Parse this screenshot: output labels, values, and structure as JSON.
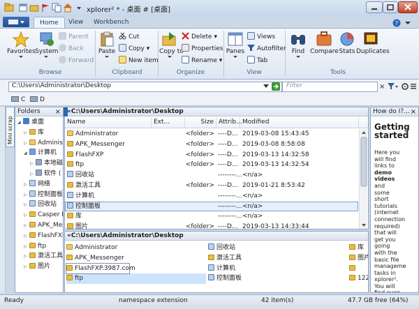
{
  "window": {
    "title": "xplorer² * - 桌面 # [桌面]"
  },
  "ribbon_tabs": [
    "Home",
    "View",
    "Workbench"
  ],
  "ribbon": {
    "browse": {
      "label": "Browse",
      "favorites": "Favorites",
      "system": "System",
      "parent": "Parent",
      "back": "Back",
      "forward": "Forward"
    },
    "clipboard": {
      "label": "Clipboard",
      "paste": "Paste",
      "cut": "Cut",
      "copy": "Copy",
      "new_item": "New item"
    },
    "organize": {
      "label": "Organize",
      "copy_to": "Copy to",
      "delete": "Delete",
      "properties": "Properties",
      "rename": "Rename"
    },
    "view": {
      "label": "View",
      "panes": "Panes",
      "views": "Views",
      "autofilter": "Autofilter",
      "tab": "Tab"
    },
    "tools": {
      "label": "Tools",
      "find": "Find",
      "compare": "Compare",
      "stats": "Stats",
      "duplicates": "Duplicates"
    }
  },
  "address": {
    "path": "C:\\Users\\Administrator\\Desktop",
    "filter_placeholder": "Filter"
  },
  "drives": [
    "C",
    "D"
  ],
  "folders_pane": {
    "title": "Folders",
    "side_tab": "Mini scrap",
    "items": [
      {
        "label": "桌面",
        "indent": 0,
        "kind": "desk"
      },
      {
        "label": "库",
        "indent": 1,
        "kind": "folder"
      },
      {
        "label": "Administ",
        "indent": 1,
        "kind": "user"
      },
      {
        "label": "计算机",
        "indent": 1,
        "kind": "pc"
      },
      {
        "label": "本地磁",
        "indent": 2,
        "kind": "drive"
      },
      {
        "label": "软件 (",
        "indent": 2,
        "kind": "drive"
      },
      {
        "label": "网络",
        "indent": 1,
        "kind": "sys"
      },
      {
        "label": "控制面板",
        "indent": 1,
        "kind": "sys"
      },
      {
        "label": "回收站",
        "indent": 1,
        "kind": "sys"
      },
      {
        "label": "Casper B",
        "indent": 1,
        "kind": "folder"
      },
      {
        "label": "APK_Mess",
        "indent": 1,
        "kind": "folder"
      },
      {
        "label": "FlashFXP.",
        "indent": 1,
        "kind": "folder"
      },
      {
        "label": "ftp",
        "indent": 1,
        "kind": "folder"
      },
      {
        "label": "激活工具",
        "indent": 1,
        "kind": "folder"
      },
      {
        "label": "图片",
        "indent": 1,
        "kind": "folder"
      }
    ]
  },
  "top_pane": {
    "path": "«C:\\Users\\Administrator\\Desktop",
    "columns": [
      "Name",
      "Ext...",
      "Size",
      "Attrib...",
      "Modified"
    ],
    "rows": [
      {
        "name": "Administrator",
        "ext": "",
        "size": "<folder>",
        "attr": "----D...",
        "modified": "2019-03-08 15:43:45",
        "kind": "user"
      },
      {
        "name": "APK_Messenger",
        "ext": "",
        "size": "<folder>",
        "attr": "----D...",
        "modified": "2019-03-08 8:58:08",
        "kind": "folder"
      },
      {
        "name": "FlashFXP",
        "ext": "",
        "size": "<folder>",
        "attr": "----D...",
        "modified": "2019-03-13 14:32:58",
        "kind": "folder"
      },
      {
        "name": "ftp",
        "ext": "",
        "size": "<folder>",
        "attr": "----D...",
        "modified": "2019-03-13 14:32:54",
        "kind": "folder"
      },
      {
        "name": "回收站",
        "ext": "",
        "size": "",
        "attr": "--------...",
        "modified": "<n/a>",
        "kind": "sys"
      },
      {
        "name": "激活工具",
        "ext": "",
        "size": "<folder>",
        "attr": "----D...",
        "modified": "2019-01-21 8:53:42",
        "kind": "folder"
      },
      {
        "name": "计算机",
        "ext": "",
        "size": "",
        "attr": "--------...",
        "modified": "<n/a>",
        "kind": "sys"
      },
      {
        "name": "控制面板",
        "ext": "",
        "size": "",
        "attr": "--------...",
        "modified": "<n/a>",
        "kind": "sys"
      },
      {
        "name": "库",
        "ext": "",
        "size": "",
        "attr": "--------...",
        "modified": "<n/a>",
        "kind": "folder"
      },
      {
        "name": "图片",
        "ext": "",
        "size": "<folder>",
        "attr": "----D...",
        "modified": "2019-03-13 14:33:44",
        "kind": "folder"
      }
    ]
  },
  "bottom_pane": {
    "path": "«C:\\Users\\Administrator\\Desktop",
    "col1": [
      "Administrator",
      "APK_Messenger",
      "FlashFXP.3987.com",
      "ftp"
    ],
    "col2": [
      "回收站",
      "激活工具",
      "计算机",
      "控制面板"
    ],
    "col3": [
      "库",
      "图片",
      "",
      "122"
    ]
  },
  "howto": {
    "title": "How do I?...",
    "heading": "Getting started",
    "body_lines": [
      "Here you",
      "will find",
      "links to",
      "demo",
      "videos",
      "and",
      "some",
      "short",
      "tutorials",
      "(internet",
      "connection",
      "required)",
      "that will",
      "get you",
      "going",
      "with the",
      "basic file",
      "manageme",
      "tasks in",
      "xplorer².",
      "You will",
      "find even",
      "more",
      "useful"
    ]
  },
  "status": {
    "left": "Ready",
    "type": "namespace extension",
    "count": "42 item(s)",
    "free": "47.7 GB free (64%)"
  },
  "colors": {
    "accent": "#1e4d94",
    "folder": "#e8bb47",
    "selection": "#cde3fb"
  }
}
